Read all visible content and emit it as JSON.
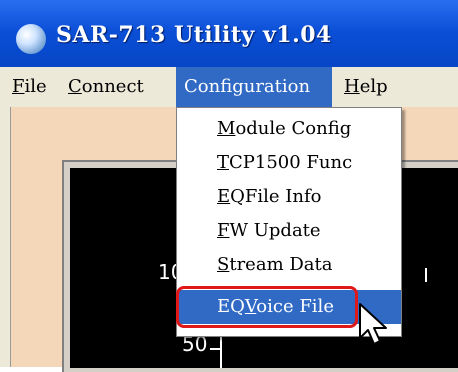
{
  "window": {
    "title": "SAR-713 Utility v1.04",
    "icon": "globe-icon"
  },
  "menubar": {
    "items": [
      {
        "id": "file",
        "label_rest": "ile",
        "mnemonic": "F"
      },
      {
        "id": "connect",
        "label_rest": "onnect",
        "mnemonic": "C"
      },
      {
        "id": "configuration",
        "label": "Configuration"
      },
      {
        "id": "help",
        "label_rest": "elp",
        "mnemonic": "H"
      }
    ]
  },
  "dropdown": {
    "items": [
      {
        "mnemonic": "M",
        "rest": "odule Config"
      },
      {
        "mnemonic": "T",
        "rest": "CP1500 Func"
      },
      {
        "mnemonic": "E",
        "rest": "QFile Info"
      },
      {
        "mnemonic": "F",
        "rest": "W Update"
      },
      {
        "mnemonic": "S",
        "rest": "tream Data"
      },
      {
        "pre": "EQ",
        "mnemonic": "V",
        "rest": "oice File",
        "highlighted": true
      }
    ]
  },
  "chart": {
    "ticks": [
      "10",
      "50"
    ]
  },
  "colors": {
    "title_bar": "#0a4fd6",
    "menu_highlight": "#316ac5",
    "client_bg": "#f4d6b8",
    "annotation_ring": "#e01818"
  },
  "pointer": "mouse-cursor-icon"
}
